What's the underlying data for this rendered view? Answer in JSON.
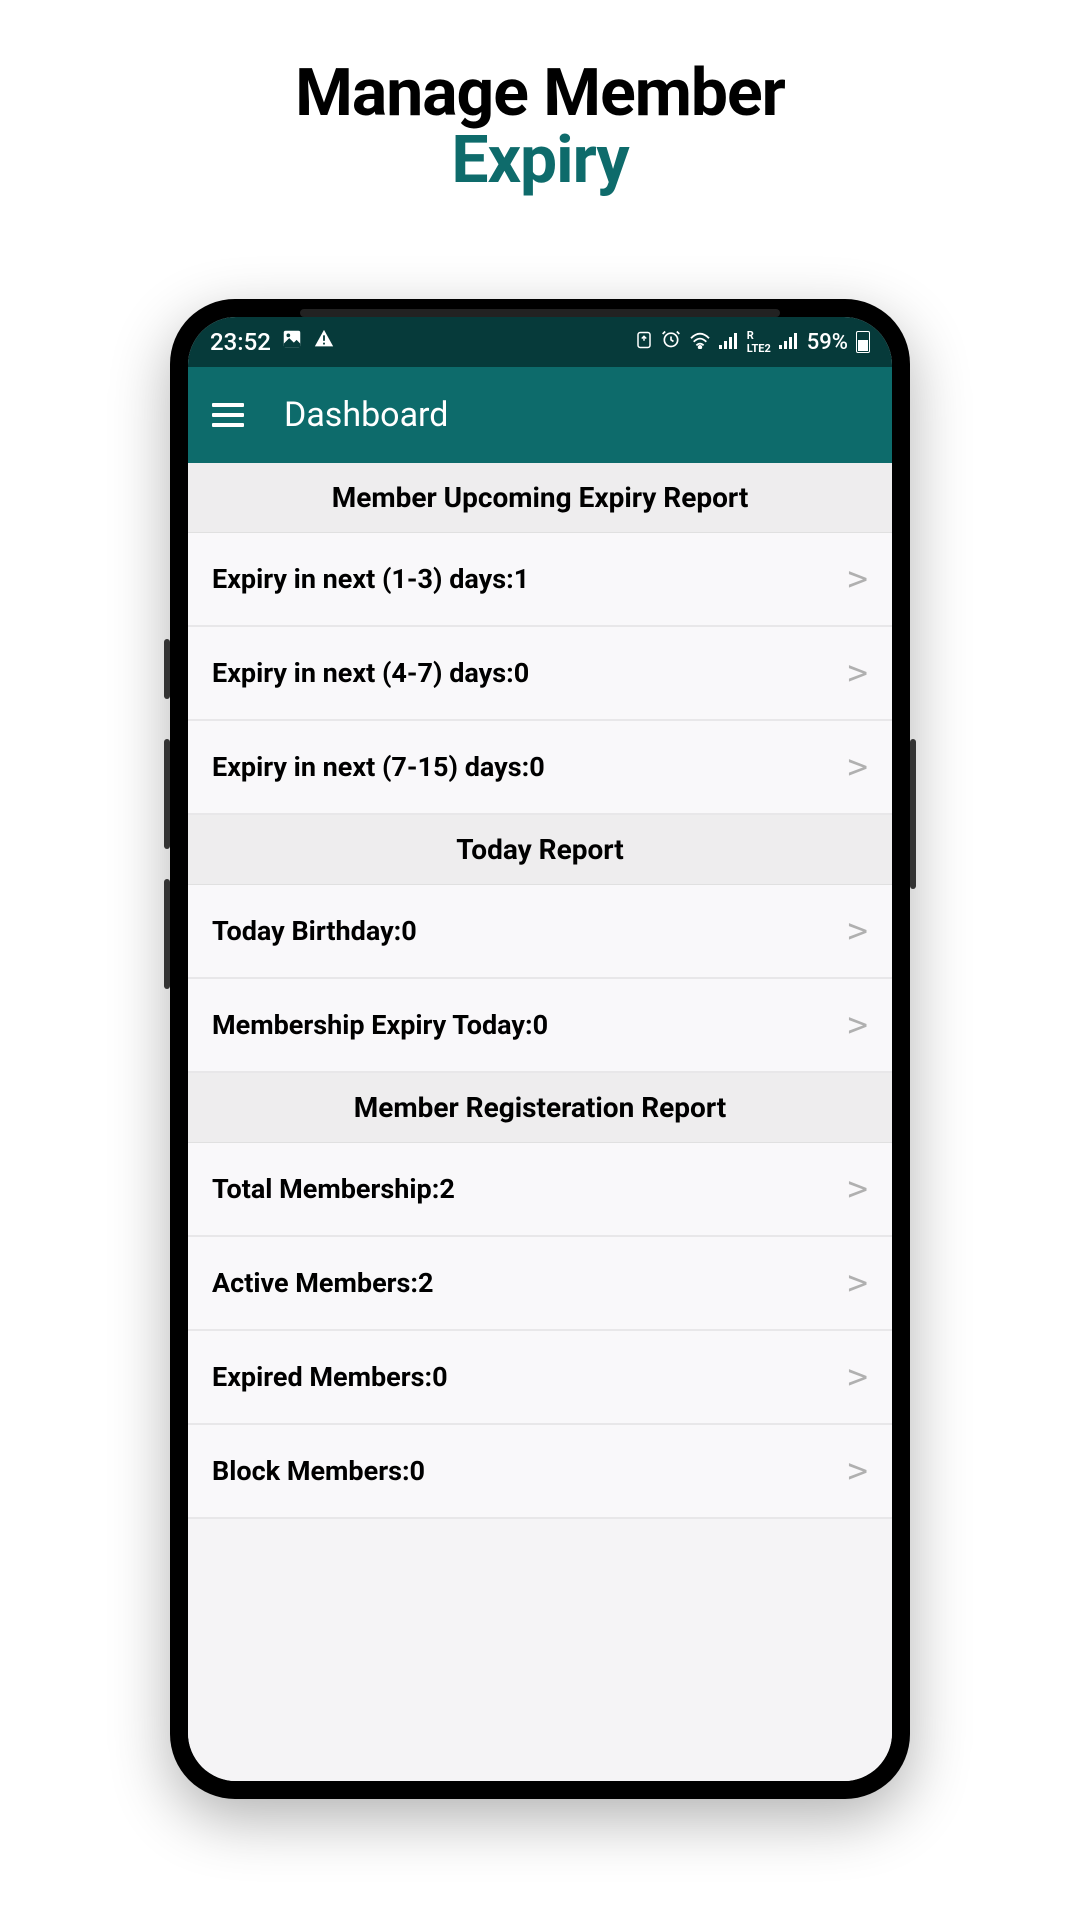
{
  "heading": {
    "line1": "Manage Member",
    "line2": "Expiry"
  },
  "statusBar": {
    "time": "23:52",
    "batteryPercent": "59%"
  },
  "appBar": {
    "title": "Dashboard"
  },
  "sections": [
    {
      "header": "Member Upcoming Expiry Report",
      "items": [
        {
          "label": "Expiry in next (1-3) days:1"
        },
        {
          "label": "Expiry in next (4-7) days:0"
        },
        {
          "label": "Expiry in next (7-15) days:0"
        }
      ]
    },
    {
      "header": "Today Report",
      "items": [
        {
          "label": "Today Birthday:0"
        },
        {
          "label": "Membership Expiry Today:0"
        }
      ]
    },
    {
      "header": "Member Registeration Report",
      "items": [
        {
          "label": "Total Membership:2"
        },
        {
          "label": "Active Members:2"
        },
        {
          "label": "Expired Members:0"
        },
        {
          "label": "Block Members:0"
        }
      ]
    }
  ]
}
